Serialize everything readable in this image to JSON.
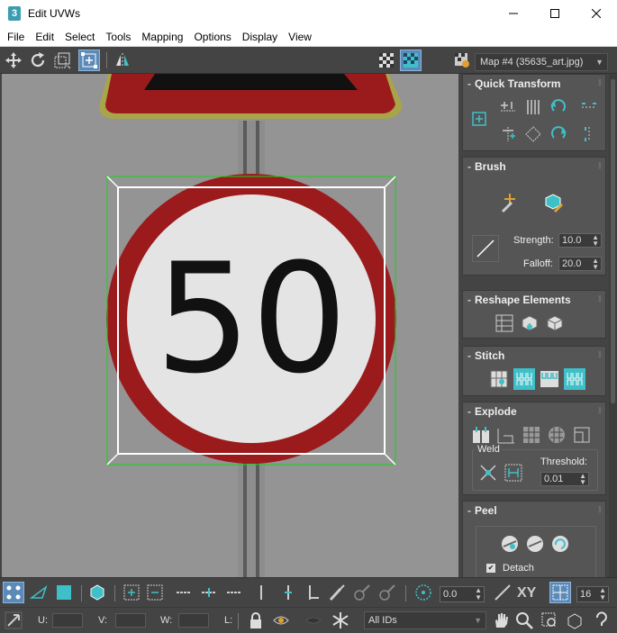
{
  "window": {
    "title": "Edit UVWs",
    "app_icon_glyph": "3"
  },
  "menu": [
    "File",
    "Edit",
    "Select",
    "Tools",
    "Mapping",
    "Options",
    "Display",
    "View"
  ],
  "toolbar": {
    "uv_label": "UV",
    "map_select": "Map #4 (35635_art.jpg)"
  },
  "viewport": {
    "sign_number": "50"
  },
  "panel": {
    "quick_transform": {
      "title": "Quick Transform"
    },
    "brush": {
      "title": "Brush",
      "strength_label": "Strength:",
      "strength_value": "10.0",
      "falloff_label": "Falloff:",
      "falloff_value": "20.0"
    },
    "reshape": {
      "title": "Reshape Elements"
    },
    "stitch": {
      "title": "Stitch"
    },
    "explode": {
      "title": "Explode",
      "weld_label": "Weld",
      "threshold_label": "Threshold:",
      "threshold_value": "0.01"
    },
    "peel": {
      "title": "Peel",
      "detach_label": "Detach",
      "detach_checked": "✔"
    }
  },
  "bottom": {
    "angle_value": "0.0",
    "xy_label": "XY",
    "grid_value": "16",
    "u_label": "U:",
    "v_label": "V:",
    "w_label": "W:",
    "l_label": "L:",
    "ids_select": "All IDs"
  },
  "colors": {
    "accent": "#3fc0c8",
    "sign_red": "#9b1b1d",
    "sign_text": "#111111",
    "viewport_bg": "#949494"
  }
}
